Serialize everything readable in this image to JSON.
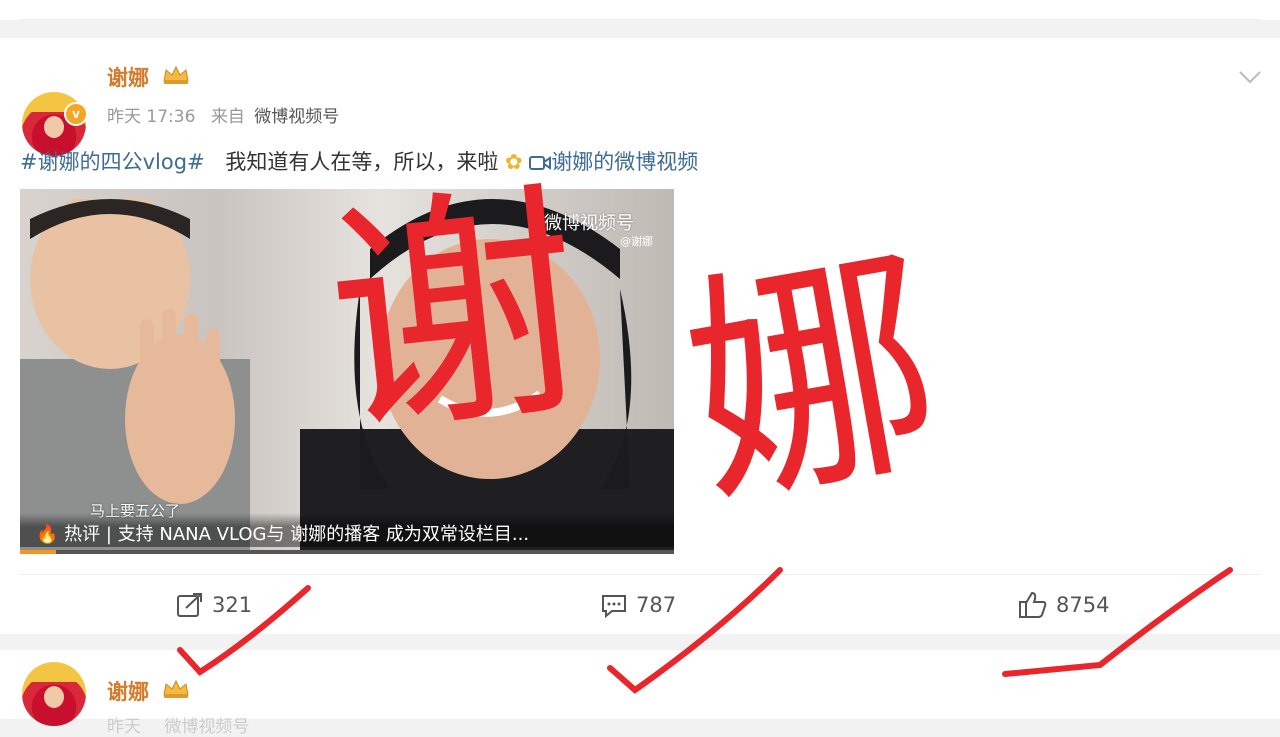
{
  "post": {
    "username": "谢娜",
    "time": "昨天 17:36",
    "source_prefix": "来自",
    "source": "微博视频号",
    "topic": "#谢娜的四公vlog#",
    "text": "我知道有人在等，所以，来啦",
    "video_link": "谢娜的微博视频"
  },
  "video": {
    "watermark": "微博视频号",
    "watermark_sub": "@谢娜",
    "danmaku": "马上要五公了",
    "hot_comment": "热评 | 支持 NANA VLOG与 谢娜的播客 成为双常设栏目...",
    "progress": 0.055
  },
  "actions": {
    "repost_count": "321",
    "comment_count": "787",
    "like_count": "8754"
  },
  "next_post": {
    "username": "谢娜",
    "time": "昨天",
    "source": "微博视频号"
  },
  "annotation": {
    "char1": "谢",
    "char2": "娜",
    "color": "#e8262c"
  },
  "colors": {
    "username": "#d57b2c",
    "link": "#3f6c96",
    "verified": "#f5a623"
  },
  "icons": [
    "crown-icon",
    "chevron-down-icon",
    "video-icon",
    "fire-icon",
    "repost-icon",
    "comment-icon",
    "like-icon",
    "checkmark-icon"
  ]
}
